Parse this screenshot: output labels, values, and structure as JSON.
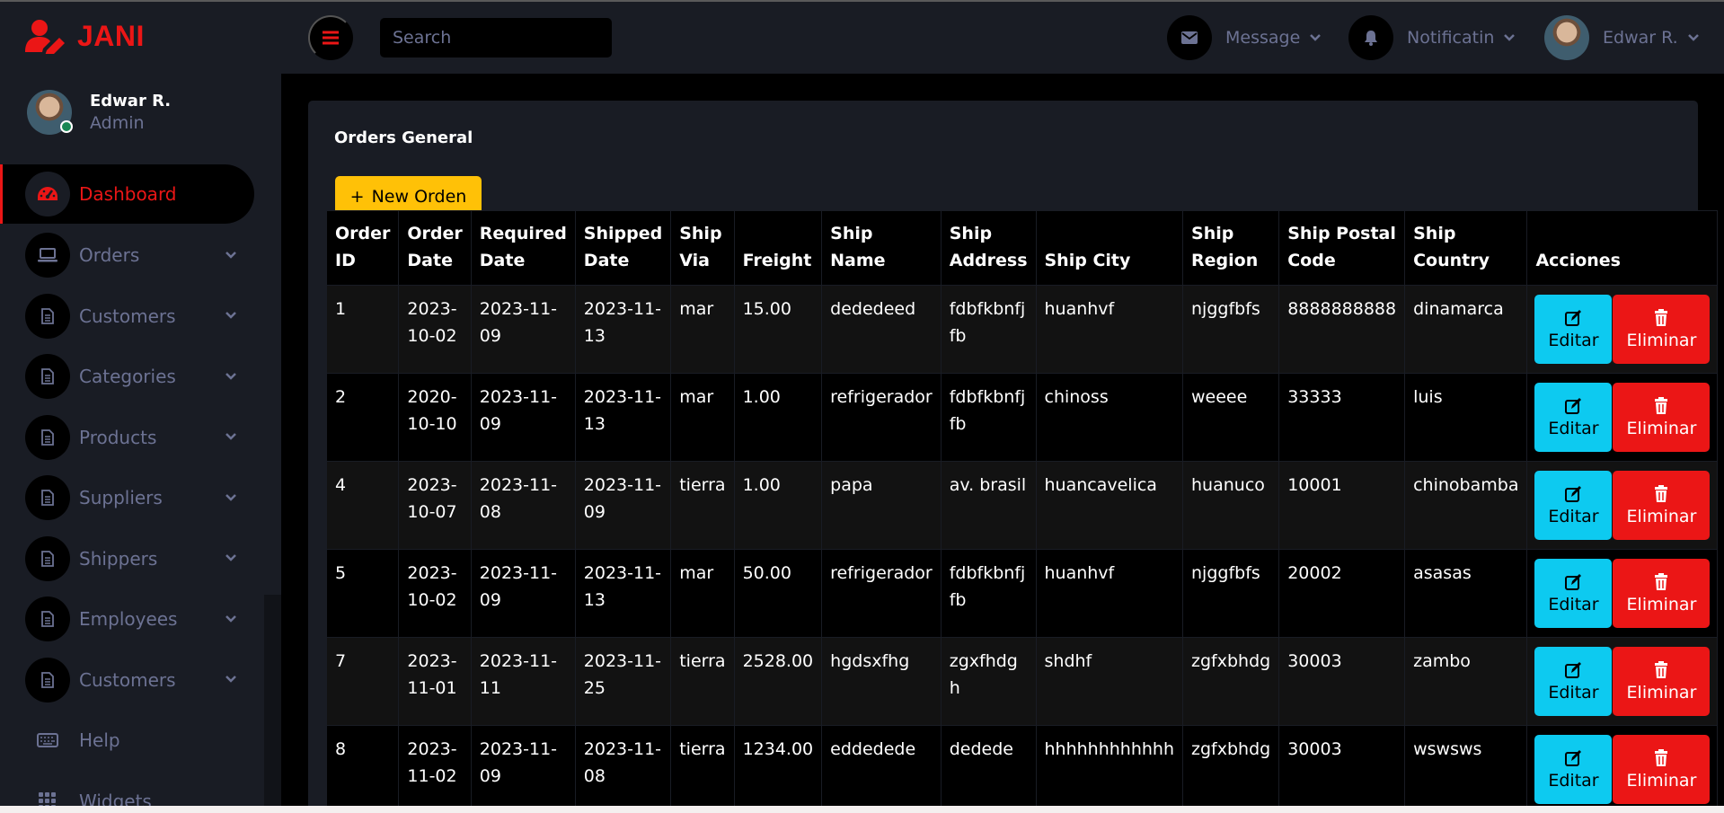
{
  "brand": {
    "name": "JANI",
    "color": "#eb1616",
    "icon": "user-edit-icon"
  },
  "profile": {
    "name": "Edwar R.",
    "role": "Admin"
  },
  "nav": {
    "items": [
      {
        "label": "Dashboard",
        "icon": "tachometer-icon",
        "active": true
      },
      {
        "label": "Orders",
        "icon": "laptop-icon"
      },
      {
        "label": "Customers",
        "icon": "file-icon"
      },
      {
        "label": "Categories",
        "icon": "file-icon"
      },
      {
        "label": "Products",
        "icon": "file-icon"
      },
      {
        "label": "Suppliers",
        "icon": "file-icon"
      },
      {
        "label": "Shippers",
        "icon": "file-icon"
      },
      {
        "label": "Employees",
        "icon": "file-icon"
      },
      {
        "label": "Customers",
        "icon": "file-icon"
      },
      {
        "label": "Help",
        "icon": "keyboard-icon"
      },
      {
        "label": "Widgets",
        "icon": "grid-icon"
      }
    ]
  },
  "topbar": {
    "search_placeholder": "Search",
    "message_label": "Message",
    "notification_label": "Notificatin",
    "user_label": "Edwar R."
  },
  "card": {
    "title": "Orders General",
    "new_button_label": "New Orden"
  },
  "table": {
    "headers": [
      "Order ID",
      "Order Date",
      "Required Date",
      "Shipped Date",
      "Ship Via",
      "Freight",
      "Ship Name",
      "Ship Address",
      "Ship City",
      "Ship Region",
      "Ship Postal Code",
      "Ship Country",
      "Acciones"
    ],
    "rows": [
      [
        "1",
        "2023-10-02",
        "2023-11-09",
        "2023-11-13",
        "mar",
        "15.00",
        "dededeed",
        "fdbfkbnfjfb",
        "huanhvf",
        "njggfbfs",
        "8888888888",
        "dinamarca"
      ],
      [
        "2",
        "2020-10-10",
        "2023-11-09",
        "2023-11-13",
        "mar",
        "1.00",
        "refrigerador",
        "fdbfkbnfjfb",
        "chinoss",
        "weeee",
        "33333",
        "luis"
      ],
      [
        "4",
        "2023-10-07",
        "2023-11-08",
        "2023-11-09",
        "tierra",
        "1.00",
        "papa",
        "av. brasil",
        "huancavelica",
        "huanuco",
        "10001",
        "chinobamba"
      ],
      [
        "5",
        "2023-10-02",
        "2023-11-09",
        "2023-11-13",
        "mar",
        "50.00",
        "refrigerador",
        "fdbfkbnfjfb",
        "huanhvf",
        "njggfbfs",
        "20002",
        "asasas"
      ],
      [
        "7",
        "2023-11-01",
        "2023-11-11",
        "2023-11-25",
        "tierra",
        "2528.00",
        "hgdsxfhg",
        "zgxfhdgh",
        "shdhf",
        "zgfxbhdg",
        "30003",
        "zambo"
      ],
      [
        "8",
        "2023-11-02",
        "2023-11-09",
        "2023-11-08",
        "tierra",
        "1234.00",
        "eddedede",
        "dedede",
        "hhhhhhhhhhhh",
        "zgfxbhdg",
        "30003",
        "wswsws"
      ]
    ],
    "edit_label": "Editar",
    "delete_label": "Eliminar"
  },
  "colors": {
    "primary": "#eb1616",
    "secondary": "#191c24",
    "muted": "#6c7293",
    "warning": "#ffc107",
    "info": "#0dcaf0"
  }
}
